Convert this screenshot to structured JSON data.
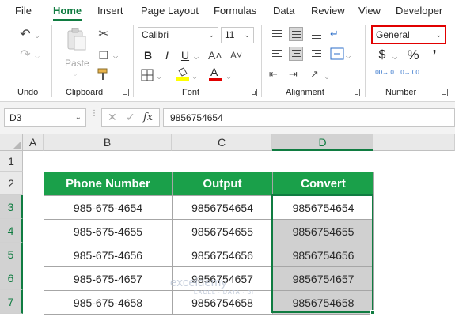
{
  "tabs": [
    "File",
    "Home",
    "Insert",
    "Page Layout",
    "Formulas",
    "Data",
    "Review",
    "View",
    "Developer"
  ],
  "active_tab": "Home",
  "ribbon": {
    "undo_group": "Undo",
    "clipboard_group": "Clipboard",
    "paste_label": "Paste",
    "font_group": "Font",
    "font_name": "Calibri",
    "font_size": "11",
    "bold": "B",
    "italic": "I",
    "underline": "U",
    "alignment_group": "Alignment",
    "number_group": "Number",
    "number_format": "General",
    "currency": "$",
    "percent": "%",
    "comma": "’",
    "increase_decimal": ".00→.0",
    "decrease_decimal": ".0→.00"
  },
  "formula_bar": {
    "name_box": "D3",
    "cancel": "✕",
    "enter": "✓",
    "fx": "fx",
    "value": "9856754654"
  },
  "grid": {
    "columns": [
      "A",
      "B",
      "C",
      "D"
    ],
    "rows": [
      "1",
      "2",
      "3",
      "4",
      "5",
      "6",
      "7"
    ],
    "selected_column": "D"
  },
  "table": {
    "headers": [
      "Phone Number",
      "Output",
      "Convert"
    ],
    "rows": [
      [
        "985-675-4654",
        "9856754654",
        "9856754654"
      ],
      [
        "985-675-4655",
        "9856754655",
        "9856754655"
      ],
      [
        "985-675-4656",
        "9856754656",
        "9856754656"
      ],
      [
        "985-675-4657",
        "9856754657",
        "9856754657"
      ],
      [
        "985-675-4658",
        "9856754658",
        "9856754658"
      ]
    ]
  },
  "watermark": {
    "name": "exceldemy",
    "tagline": "EXCEL · DATA · BI"
  },
  "colors": {
    "accent": "#107c41",
    "header_fill": "#1aa04a",
    "highlight": "#e10000"
  }
}
